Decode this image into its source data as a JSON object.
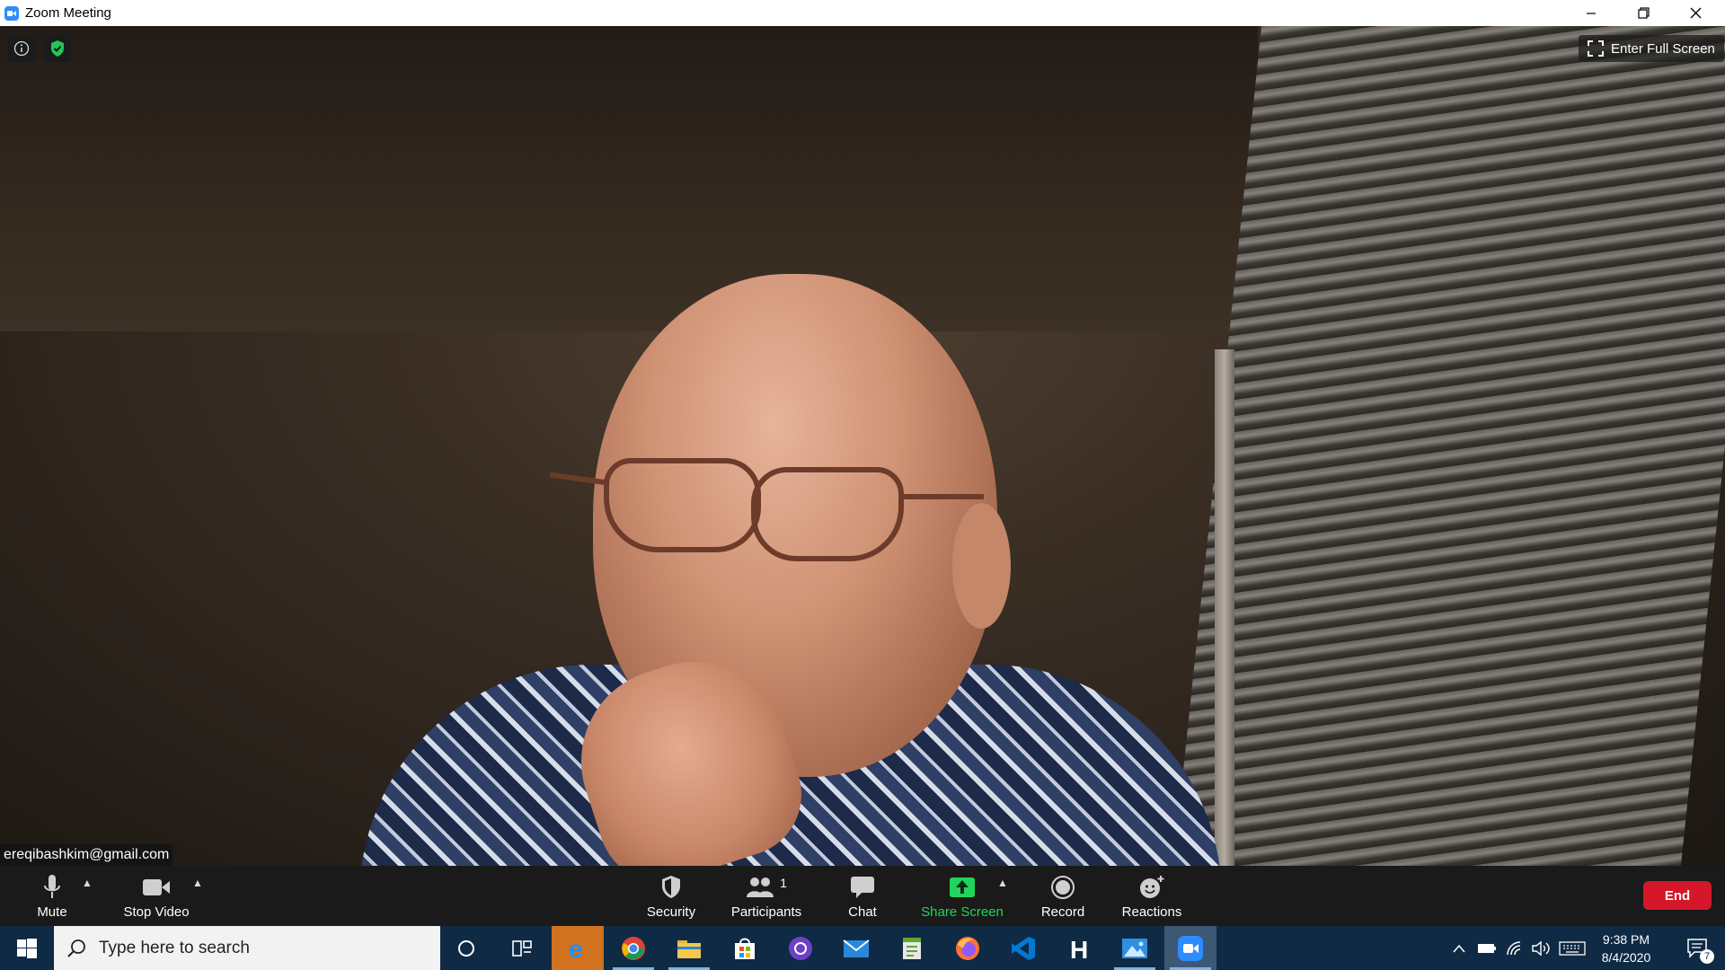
{
  "window": {
    "title": "Zoom Meeting",
    "icon": "zoom-camera-icon"
  },
  "video": {
    "participant_name": "ereqibashkim@gmail.com",
    "fullscreen_label": "Enter Full Screen"
  },
  "toolbar": {
    "mute_label": "Mute",
    "stop_video_label": "Stop Video",
    "security_label": "Security",
    "participants_label": "Participants",
    "participants_count": "1",
    "chat_label": "Chat",
    "share_screen_label": "Share Screen",
    "record_label": "Record",
    "reactions_label": "Reactions",
    "end_label": "End"
  },
  "taskbar": {
    "search_placeholder": "Type here to search",
    "time": "9:38 PM",
    "date": "8/4/2020",
    "notifications_count": "7",
    "apps": [
      "edge-icon",
      "chrome-icon",
      "file-explorer-icon",
      "store-icon",
      "github-icon",
      "mail-icon",
      "notepad-icon",
      "firefox-icon",
      "vscode-icon",
      "h-app-icon",
      "photos-icon",
      "zoom-icon"
    ]
  },
  "colors": {
    "share_green": "#21d45b",
    "end_red": "#d4172a",
    "toolbar_bg": "#1a1a1a",
    "taskbar_bg": "#0f2a44"
  }
}
